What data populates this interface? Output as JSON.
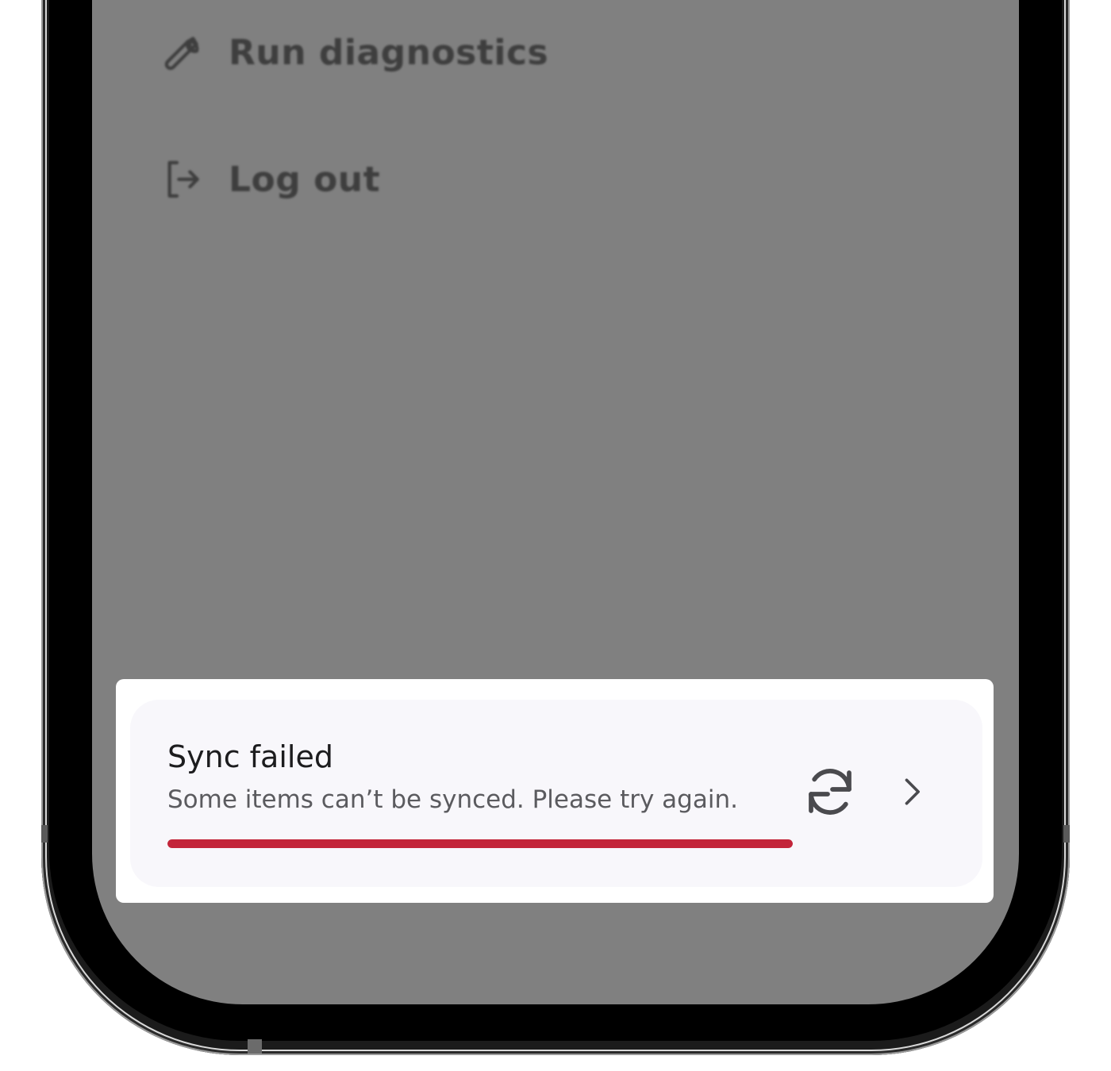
{
  "menu": {
    "items": [
      {
        "label": "Run diagnostics",
        "icon": "wrench-icon"
      },
      {
        "label": "Log out",
        "icon": "logout-icon"
      }
    ]
  },
  "toast": {
    "title": "Sync failed",
    "message": "Some items can’t be synced. Please try again.",
    "progress": 1.0,
    "retry_icon": "refresh-icon",
    "details_icon": "chevron-right-icon"
  },
  "colors": {
    "overlay": "#808080",
    "progress": "#c3253a",
    "toast_background": "#f8f7fb"
  }
}
